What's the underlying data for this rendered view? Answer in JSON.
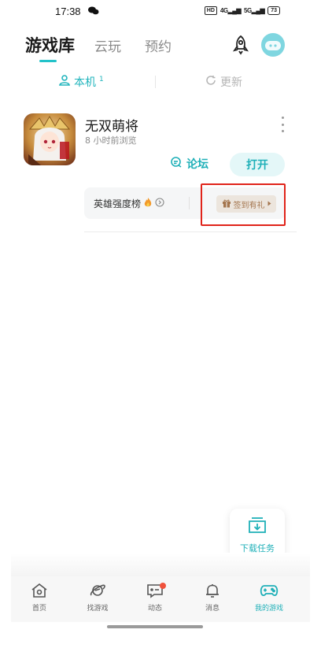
{
  "status_bar": {
    "time": "17:38",
    "network": "4G",
    "network2": "5G",
    "hd": "HD",
    "battery": "73"
  },
  "header": {
    "tabs": [
      {
        "label": "游戏库",
        "active": true
      },
      {
        "label": "云玩",
        "active": false
      },
      {
        "label": "预约",
        "active": false
      }
    ]
  },
  "sub_tabs": {
    "local_label": "本机",
    "local_count": "1",
    "update_label": "更新"
  },
  "game": {
    "title": "无双萌将",
    "last_seen": "8 小时前浏览",
    "forum_label": "论坛",
    "open_label": "打开",
    "rank_label": "英雄强度榜",
    "signin_label": "签到有礼"
  },
  "download": {
    "label": "下载任务"
  },
  "nav": {
    "items": [
      {
        "label": "首页",
        "icon": "home-icon",
        "active": false
      },
      {
        "label": "找游戏",
        "icon": "planet-icon",
        "active": false
      },
      {
        "label": "动态",
        "icon": "chat-icon",
        "active": false
      },
      {
        "label": "消息",
        "icon": "bell-icon",
        "active": false
      },
      {
        "label": "我的游戏",
        "icon": "gamepad-icon",
        "active": true
      }
    ]
  },
  "colors": {
    "accent": "#1fb0b8",
    "highlight_box": "#e0231a",
    "signin_bg": "#ece5dd",
    "signin_text": "#a4764f"
  }
}
